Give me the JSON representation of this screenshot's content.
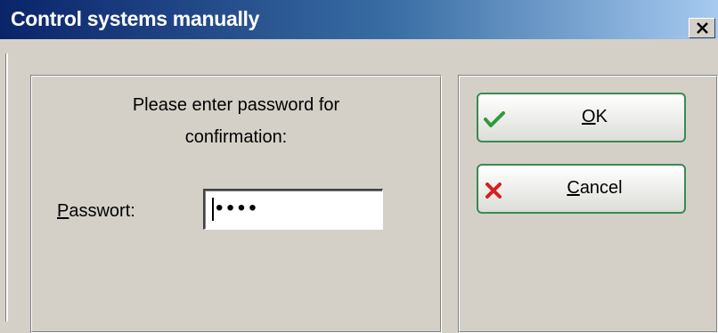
{
  "window": {
    "title": "Control systems manually",
    "close_icon": "close-icon"
  },
  "prompt": {
    "line1": "Please enter password for",
    "line2": "confirmation:"
  },
  "password": {
    "label_first": "P",
    "label_rest": "asswort:",
    "value": "••••"
  },
  "buttons": {
    "ok": {
      "label_first": "O",
      "label_rest": "K",
      "icon": "checkmark-icon",
      "icon_color": "#2e9a3a"
    },
    "cancel": {
      "label_first": "C",
      "label_rest": "ancel",
      "icon": "x-icon",
      "icon_color": "#d42020"
    }
  },
  "colors": {
    "titlebar_start": "#0a246a",
    "titlebar_end": "#a6caf0",
    "button_border": "#3a8a52",
    "dialog_bg": "#d4d0c8"
  }
}
